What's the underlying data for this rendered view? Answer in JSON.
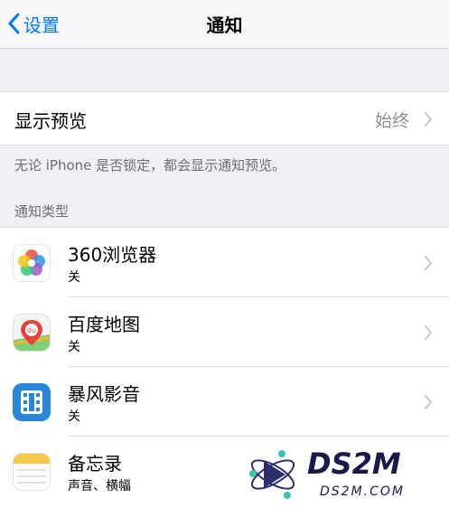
{
  "navbar": {
    "back_label": "设置",
    "title": "通知"
  },
  "preview": {
    "label": "显示预览",
    "value": "始终"
  },
  "preview_footnote": "无论 iPhone 是否锁定，都会显示通知预览。",
  "section_header": "通知类型",
  "apps": [
    {
      "name": "360浏览器",
      "status": "关",
      "icon": "360-browser-icon"
    },
    {
      "name": "百度地图",
      "status": "关",
      "icon": "baidu-maps-icon"
    },
    {
      "name": "暴风影音",
      "status": "关",
      "icon": "baofeng-video-icon"
    },
    {
      "name": "备忘录",
      "status": "声音、横幅",
      "icon": "notes-icon"
    }
  ],
  "watermark": {
    "logo_text": "DS2M",
    "site": "DS2M.COM"
  },
  "colors": {
    "accent": "#007aff",
    "secondary_text": "#8e8e93",
    "background": "#efeff4"
  }
}
